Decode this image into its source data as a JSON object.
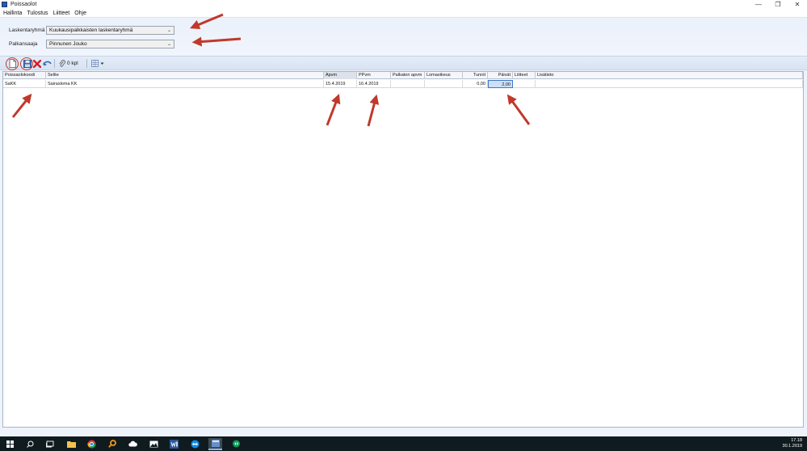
{
  "window": {
    "title": "Poissaolot",
    "minimize_glyph": "—",
    "restore_glyph": "❐",
    "close_glyph": "✕"
  },
  "menu": [
    "Hallinta",
    "Tulostus",
    "Liitteet",
    "Ohje"
  ],
  "form": {
    "group_label": "Laskentaryhmä",
    "group_value": "Kuukausipalkkaisten laskentaryhmä",
    "employee_label": "Palkansaaja",
    "employee_value": "Pinnunen Jouko"
  },
  "toolbar": {
    "count": "0 kpl",
    "icons": [
      "new-icon",
      "save-icon",
      "delete-icon",
      "undo-icon",
      "attachment-icon",
      "grid-layout-icon"
    ]
  },
  "table": {
    "columns": [
      "Poissaolokoodi",
      "Selite",
      "Apvm",
      "PPvm",
      "Palkaton apvm",
      "Lomaoikeus",
      "Tunnit",
      "Päivät",
      "Liitteet",
      "Lisätieto"
    ],
    "rows": [
      [
        "SaKK",
        "Sairasloma KK",
        "15.4.2019",
        "16.4.2019",
        "",
        "",
        "0,00",
        "2,00",
        "",
        ""
      ]
    ]
  },
  "taskbar": {
    "apps": [
      "start-icon",
      "search-icon",
      "task-view-icon",
      "file-explorer-icon",
      "chrome-icon",
      "search-app-icon",
      "cloud-icon",
      "photos-icon",
      "word-icon",
      "teamviewer-icon",
      "payroll-app-icon",
      "hangouts-icon"
    ],
    "time": "17.18",
    "date": "30.1.2019"
  },
  "colors": {
    "annotation_arrow": "#c0392b",
    "selection": "#cde0f7",
    "taskbar": "#101b20"
  }
}
